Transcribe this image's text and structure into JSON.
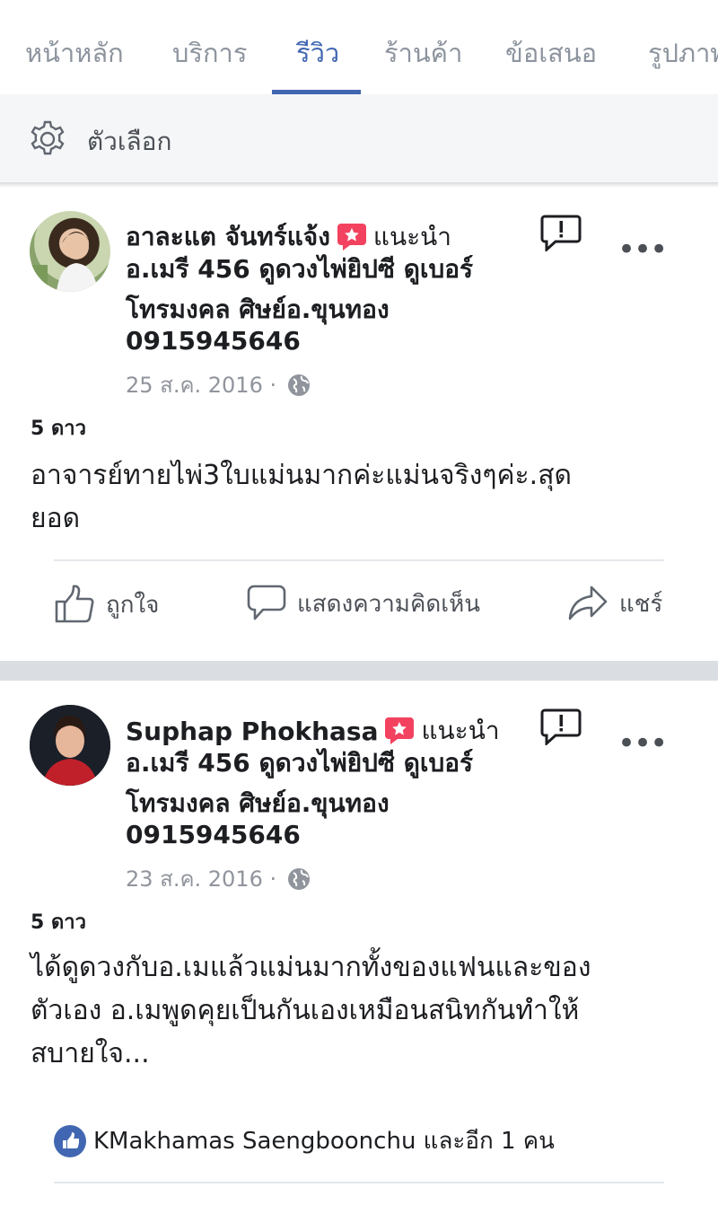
{
  "tabs": [
    {
      "label": "หน้าหลัก"
    },
    {
      "label": "บริการ"
    },
    {
      "label": "รีวิว"
    },
    {
      "label": "ร้านค้า"
    },
    {
      "label": "ข้อเสนอ"
    },
    {
      "label": "รูปภาพ"
    }
  ],
  "active_tab": "รีวิว",
  "options": {
    "label": "ตัวเลือก",
    "icon": "gear-icon"
  },
  "recommend_label": "แนะนำ",
  "actions": {
    "like": "ถูกใจ",
    "comment": "แสดงความคิดเห็น",
    "share": "แชร์"
  },
  "reviews": [
    {
      "author": "อาละแต จันทร์แจ้ง",
      "page_lines": [
        "อ.เมรี 456 ดูดวงไพ่ยิปซี ดูเบอร์",
        "โทรมงคล ศิษย์อ.ขุนทอง",
        "0915945646"
      ],
      "date": "25 ส.ค. 2016 ·",
      "stars": "5 ดาว",
      "text_lines": [
        "อาจารย์ทายไพ่3ใบแม่นมากค่ะแม่นจริงๆค่ะ.สุด",
        "ยอด"
      ]
    },
    {
      "author": "Suphap Phokhasa",
      "page_lines": [
        "อ.เมรี 456 ดูดวงไพ่ยิปซี ดูเบอร์",
        "โทรมงคล ศิษย์อ.ขุนทอง",
        "0915945646"
      ],
      "date": "23 ส.ค. 2016 ·",
      "stars": "5 ดาว",
      "text_lines": [
        "ได้ดูดวงกับอ.เมแล้วแม่นมากทั้งของแฟนและของ",
        "ตัวเอง อ.เมพูดคุยเป็นกันเองเหมือนสนิทกันทำให้",
        "สบายใจ..."
      ],
      "likes_text": "KMakhamas Saengboonchu และอีก 1 คน"
    }
  ],
  "colors": {
    "accent": "#4267b2",
    "badge": "#f3425f",
    "muted": "#90949c"
  }
}
